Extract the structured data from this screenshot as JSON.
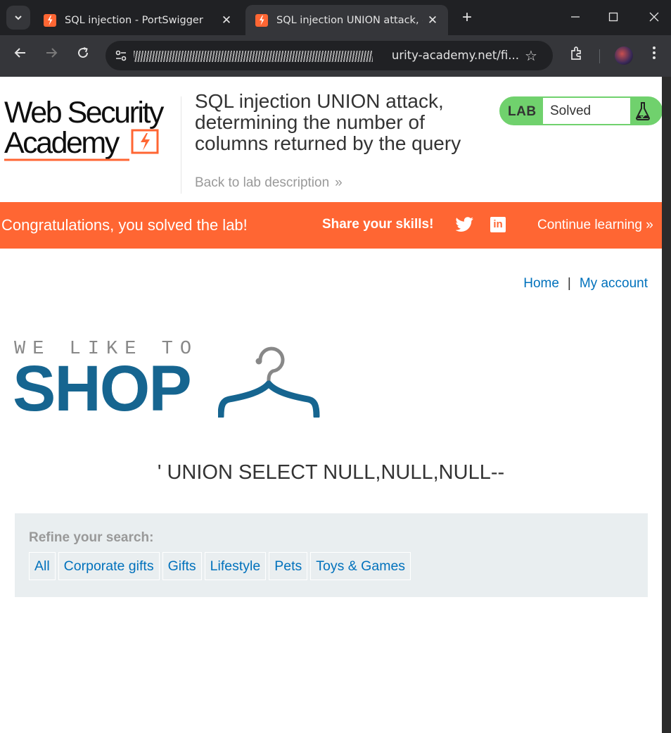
{
  "browser": {
    "tabs": [
      {
        "title": "SQL injection - PortSwigger",
        "active": false
      },
      {
        "title": "SQL injection UNION attack, de",
        "active": true
      }
    ],
    "new_tab": "+",
    "address": {
      "url_visible": "urity-academy.net/fi..."
    }
  },
  "header": {
    "logo_line1": "Web Security",
    "logo_line2": "Academy",
    "lab_title": "SQL injection UNION attack, determining the number of columns returned by the query",
    "back_link": "Back to lab description",
    "lab_badge": "LAB",
    "lab_status": "Solved"
  },
  "banner": {
    "congrats": "Congratulations, you solved the lab!",
    "share": "Share your skills!",
    "continue": "Continue learning"
  },
  "nav": {
    "home": "Home",
    "separator": "|",
    "my_account": "My account"
  },
  "shop_logo": {
    "tagline": "WE LIKE TO",
    "word": "SHOP"
  },
  "search_term": "' UNION SELECT NULL,NULL,NULL--",
  "filters": {
    "label": "Refine your search:",
    "categories": [
      "All",
      "Corporate gifts",
      "Gifts",
      "Lifestyle",
      "Pets",
      "Toys & Games"
    ]
  },
  "colors": {
    "brand_orange": "#ff6633",
    "shop_blue": "#166590",
    "link_blue": "#0071bc",
    "solved_green": "#70d16d"
  }
}
